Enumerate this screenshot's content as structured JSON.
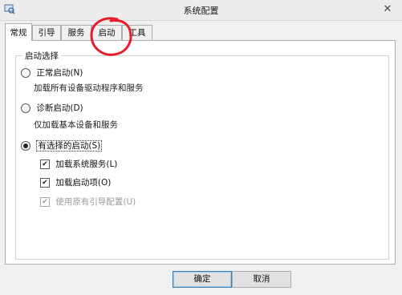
{
  "window": {
    "title": "系统配置"
  },
  "tabs": [
    {
      "label": "常规",
      "active": true
    },
    {
      "label": "引导",
      "active": false
    },
    {
      "label": "服务",
      "active": false
    },
    {
      "label": "启动",
      "active": false
    },
    {
      "label": "工具",
      "active": false
    }
  ],
  "startup": {
    "group_label": "启动选择",
    "normal": {
      "label": "正常启动(N)",
      "desc": "加载所有设备驱动程序和服务",
      "selected": false
    },
    "diagnostic": {
      "label": "诊断启动(D)",
      "desc": "仅加载基本设备和服务",
      "selected": false
    },
    "selective": {
      "label": "有选择的启动(S)",
      "selected": true
    },
    "options": [
      {
        "label": "加载系统服务(L)",
        "checked": true,
        "enabled": true
      },
      {
        "label": "加载启动项(O)",
        "checked": true,
        "enabled": true
      },
      {
        "label": "使用原有引导配置(U)",
        "checked": true,
        "enabled": false
      }
    ]
  },
  "buttons": {
    "ok": "确定",
    "cancel": "取消"
  },
  "colors": {
    "annotation": "#e81c2b"
  }
}
